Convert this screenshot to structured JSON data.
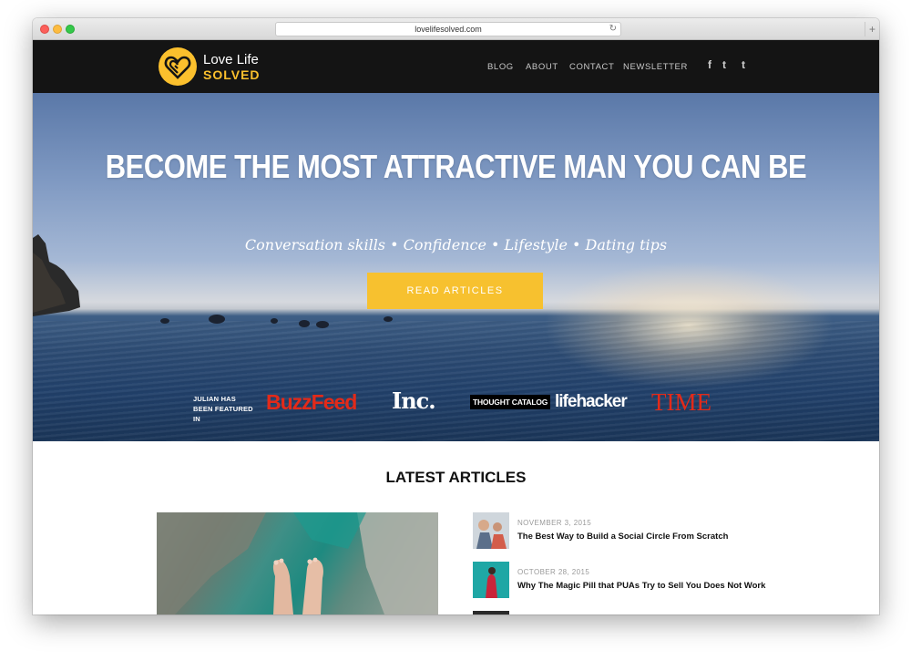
{
  "browser": {
    "url": "lovelifesolved.com",
    "reload_icon": "reload-icon",
    "newtab_label": "+"
  },
  "header": {
    "logo_line1": "Love Life",
    "logo_line2": "SOLVED",
    "nav": [
      "BLOG",
      "ABOUT",
      "CONTACT",
      "NEWSLETTER"
    ],
    "social": {
      "facebook": "f",
      "twitter": "t",
      "tumblr": "t"
    }
  },
  "hero": {
    "title": "BECOME THE MOST ATTRACTIVE MAN YOU CAN BE",
    "subtitle": "Conversation skills • Confidence • Lifestyle • Dating tips",
    "cta_label": "READ ARTICLES",
    "featured_caption": "JULIAN HAS BEEN FEATURED IN",
    "publications": [
      "BuzzFeed",
      "Inc.",
      "THOUGHT CATALOG",
      "lifehacker",
      "TIME"
    ]
  },
  "latest": {
    "heading": "LATEST ARTICLES",
    "articles": [
      {
        "date": "NOVEMBER 3, 2015",
        "title": "The Best Way to Build a Social Circle From Scratch"
      },
      {
        "date": "OCTOBER 28, 2015",
        "title": "Why The Magic Pill that PUAs Try to Sell You Does Not Work"
      }
    ]
  },
  "colors": {
    "accent": "#f7c12f",
    "header_bg": "#141414",
    "buzzfeed_red": "#e32a19"
  }
}
